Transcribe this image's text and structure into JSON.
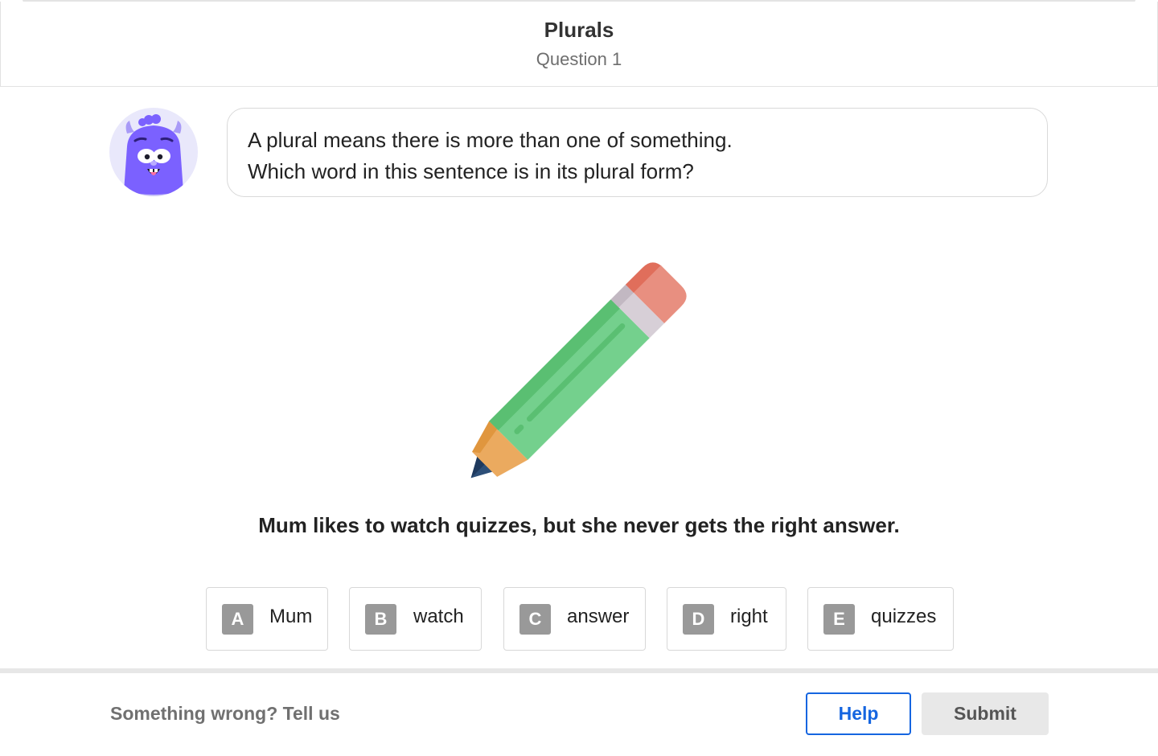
{
  "header": {
    "title": "Plurals",
    "subtitle": "Question 1"
  },
  "prompt": {
    "line1": "A plural means there is more than one of something.",
    "line2": "Which word in this sentence is in its plural form?"
  },
  "illustration": {
    "icon": "pencil-icon"
  },
  "sentence": "Mum likes to watch quizzes, but she never gets the right answer.",
  "options": [
    {
      "letter": "A",
      "text": "Mum"
    },
    {
      "letter": "B",
      "text": "watch"
    },
    {
      "letter": "C",
      "text": "answer"
    },
    {
      "letter": "D",
      "text": "right"
    },
    {
      "letter": "E",
      "text": "quizzes"
    }
  ],
  "footer": {
    "report_label": "Something wrong? Tell us",
    "help_label": "Help",
    "submit_label": "Submit"
  },
  "colors": {
    "accent": "#1565e0",
    "option_letter_bg": "#999999",
    "avatar_monster": "#7b61ff"
  }
}
